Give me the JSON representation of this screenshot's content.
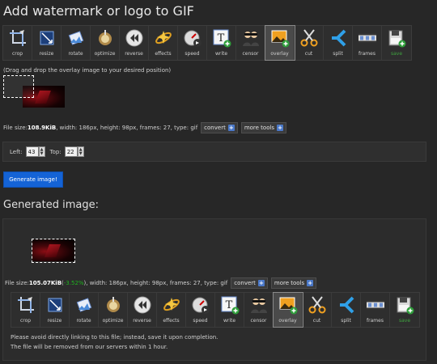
{
  "page": {
    "title": "Add watermark or logo to GIF"
  },
  "tools": [
    {
      "name": "crop",
      "label": "crop",
      "icon": "crop-icon"
    },
    {
      "name": "resize",
      "label": "resize",
      "icon": "resize-icon"
    },
    {
      "name": "rotate",
      "label": "rotate",
      "icon": "rotate-icon"
    },
    {
      "name": "optimize",
      "label": "optimize",
      "icon": "optimize-icon"
    },
    {
      "name": "reverse",
      "label": "reverse",
      "icon": "reverse-icon"
    },
    {
      "name": "effects",
      "label": "effects",
      "icon": "effects-icon"
    },
    {
      "name": "speed",
      "label": "speed",
      "icon": "speed-icon"
    },
    {
      "name": "write",
      "label": "write",
      "icon": "write-icon"
    },
    {
      "name": "censor",
      "label": "censor",
      "icon": "censor-icon"
    },
    {
      "name": "overlay",
      "label": "overlay",
      "icon": "overlay-icon",
      "active": true
    },
    {
      "name": "cut",
      "label": "cut",
      "icon": "cut-icon"
    },
    {
      "name": "split",
      "label": "split",
      "icon": "split-icon"
    },
    {
      "name": "frames",
      "label": "frames",
      "icon": "frames-icon"
    },
    {
      "name": "save",
      "label": "save",
      "icon": "save-icon",
      "green": true
    }
  ],
  "editor": {
    "hint": "(Drag and drop the overlay image to your desired position)",
    "file_prefix": "File size: ",
    "file_size": "108.9KiB",
    "file_details": ", width: 186px, height: 98px, frames: 27, type: gif",
    "convert_label": "convert",
    "more_tools_label": "more tools"
  },
  "position": {
    "left_label": "Left:",
    "left_value": "43",
    "top_label": "Top:",
    "top_value": "22"
  },
  "generate_button": "Generate image!",
  "result": {
    "title": "Generated image:",
    "file_prefix": "File size: ",
    "file_size": "105.07KiB",
    "change_open": " (",
    "change": "-3.52%",
    "change_close": ")",
    "file_details": ", width: 186px, height: 98px, frames: 27, type: gif",
    "convert_label": "convert",
    "more_tools_label": "more tools",
    "note_line1": "Please avoid directly linking to this file; instead, save it upon completion.",
    "note_line2": "The file will be removed from our servers within 1 hour."
  },
  "colors": {
    "background": "#272727",
    "accent_blue": "#1463d6",
    "positive_green": "#1fb31f"
  }
}
